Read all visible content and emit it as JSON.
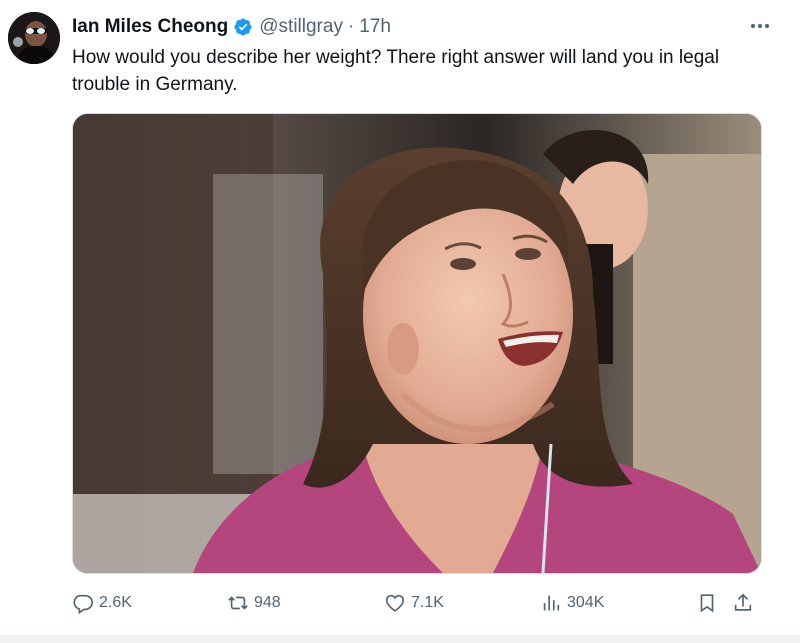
{
  "author": {
    "display_name": "Ian Miles Cheong",
    "handle": "@stillgray",
    "time": "17h",
    "verified": true
  },
  "tweet": {
    "text": "How would you describe her weight? There right answer will land you in legal trouble in Germany."
  },
  "actions": {
    "replies": "2.6K",
    "reposts": "948",
    "likes": "7.1K",
    "views": "304K"
  },
  "colors": {
    "verified_badge": "#1d9bf0",
    "secondary_text": "#536471",
    "primary_text": "#0f1419"
  },
  "icons": {
    "reply": "reply-icon",
    "repost": "repost-icon",
    "like": "heart-icon",
    "views": "views-icon",
    "bookmark": "bookmark-icon",
    "share": "share-icon",
    "more": "more-icon",
    "verified": "verified-badge-icon"
  }
}
